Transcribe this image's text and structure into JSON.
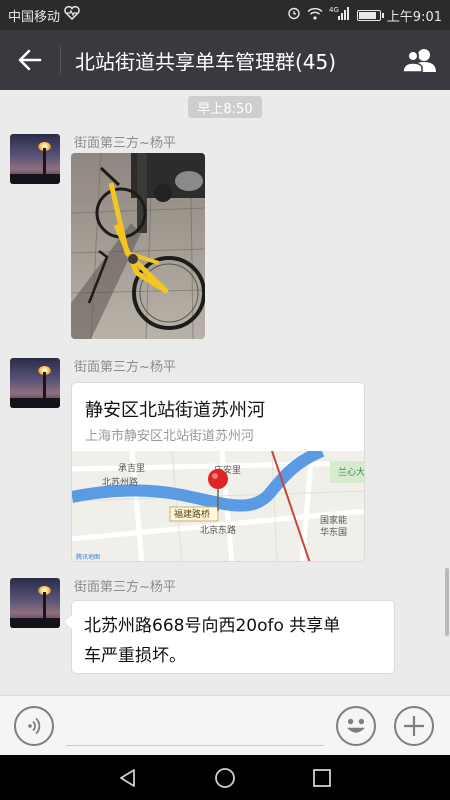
{
  "status_bar": {
    "carrier": "中国移动",
    "network_type": "4G",
    "time": "上午9:01",
    "battery_level": 0.9
  },
  "header": {
    "title": "北站街道共享单车管理群(45)"
  },
  "chat": {
    "timestamp": "早上8:50",
    "messages": [
      {
        "sender": "街面第三方~杨平",
        "type": "image"
      },
      {
        "sender": "街面第三方~杨平",
        "type": "location",
        "location_title": "静安区北站街道苏州河",
        "location_address": "上海市静安区北站街道苏州河",
        "map_labels": [
          "承吉里",
          "庆安里",
          "北苏州路",
          "福建路桥",
          "北京东路",
          "兰心大",
          "国家能",
          "华东国",
          "腾讯地图"
        ]
      },
      {
        "sender": "街面第三方~杨平",
        "type": "text",
        "text_line1": "北苏州路668号向西20ofo 共享单",
        "text_line2": "车严重损坏。"
      }
    ]
  },
  "input_bar": {
    "placeholder": ""
  },
  "colors": {
    "titlebar": "#393a3f",
    "statusbar": "#2b2b2b",
    "chat_bg": "#ebebeb",
    "bubble": "#ffffff",
    "map_river": "#4a8fe0",
    "pin": "#e02424"
  }
}
